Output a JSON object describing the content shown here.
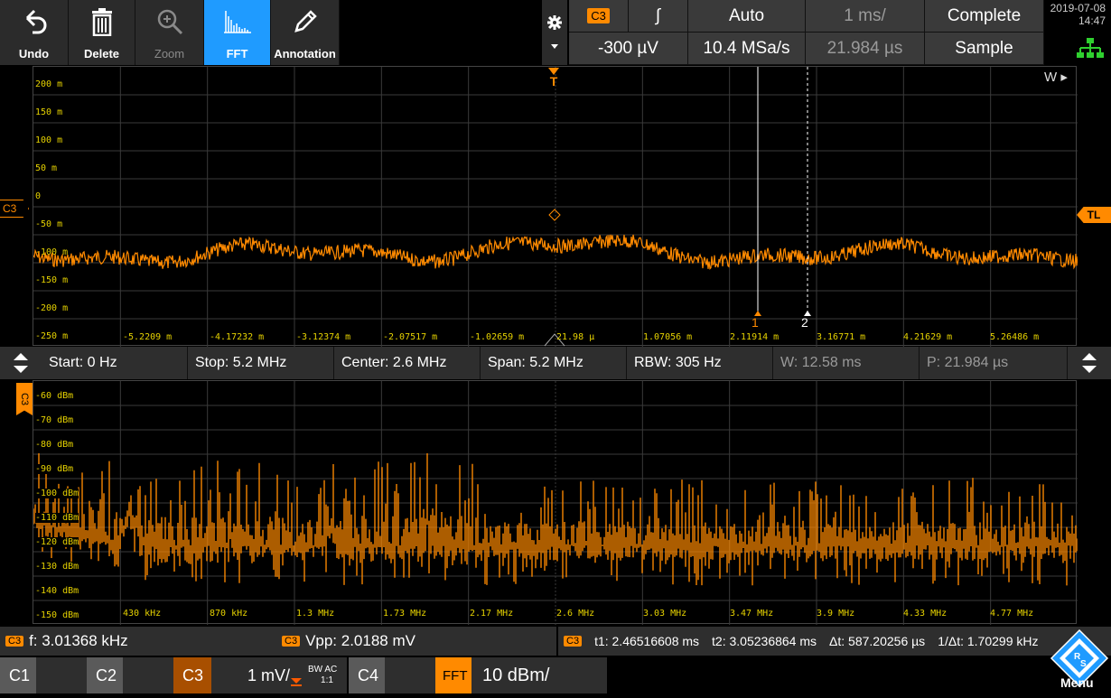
{
  "toolbar": {
    "undo": "Undo",
    "delete": "Delete",
    "zoom": "Zoom",
    "fft": "FFT",
    "annotation": "Annotation"
  },
  "header": {
    "channel": "C3",
    "trigger_slope": "∫",
    "trigger_mode": "Auto",
    "timebase": "1 ms/",
    "acq_status": "Complete",
    "trigger_level": "-300 µV",
    "sample_rate": "10.4 MSa/s",
    "position": "21.984 µs",
    "acq_mode": "Sample",
    "date": "2019-07-08",
    "time": "14:47"
  },
  "waveform": {
    "channel_tag": "C3",
    "tl_tag": "TL",
    "w_label": "W ▸",
    "trigger_marker": "T",
    "ylabels": [
      "200 m",
      "150 m",
      "100 m",
      "50 m",
      "0",
      "-50 m",
      "-100 m",
      "-150 m",
      "-200 m",
      "-250 m"
    ],
    "xlabels": [
      "-5.2209 m",
      "-4.17232 m",
      "-3.12374 m",
      "-2.07517 m",
      "-1.02659 m",
      "21.98 µ",
      "1.07056 m",
      "2.11914 m",
      "3.16771 m",
      "4.21629 m",
      "5.26486 m"
    ],
    "cursor1": "1",
    "cursor2": "2"
  },
  "fft_info": {
    "start": "Start: 0 Hz",
    "stop": "Stop: 5.2 MHz",
    "center": "Center: 2.6 MHz",
    "span": "Span: 5.2 MHz",
    "rbw": "RBW: 305 Hz",
    "w": "W: 12.58 ms",
    "p": "P: 21.984 µs"
  },
  "spectrum": {
    "channel_tag": "C3",
    "ylabels": [
      "-60 dBm",
      "-70 dBm",
      "-80 dBm",
      "-90 dBm",
      "-100 dBm",
      "-110 dBm",
      "-120 dBm",
      "-130 dBm",
      "-140 dBm",
      "-150 dBm"
    ],
    "xlabels": [
      "430 kHz",
      "870 kHz",
      "1.3 MHz",
      "1.73 MHz",
      "2.17 MHz",
      "2.6 MHz",
      "3.03 MHz",
      "3.47 MHz",
      "3.9 MHz",
      "4.33 MHz",
      "4.77 MHz"
    ]
  },
  "measurements": {
    "tag": "C3",
    "freq": "f: 3.01368 kHz",
    "vpp": "Vpp: 2.0188 mV",
    "t1": "t1: 2.46516608 ms",
    "t2": "t2: 3.05236864 ms",
    "dt": "Δt: 587.20256 µs",
    "inv_dt": "1/Δt: 1.70299 kHz"
  },
  "channels": {
    "c1": "C1",
    "c2": "C2",
    "c3": "C3",
    "c3_scale": "1 mV/",
    "c3_bw": "BW AC",
    "c3_ratio": "1:1",
    "c4": "C4",
    "fft": "FFT",
    "fft_scale": "10 dBm/",
    "menu": "Menu"
  },
  "colors": {
    "trace": "#ff8a00",
    "accent": "#1f9bff",
    "label": "#e6d200"
  }
}
